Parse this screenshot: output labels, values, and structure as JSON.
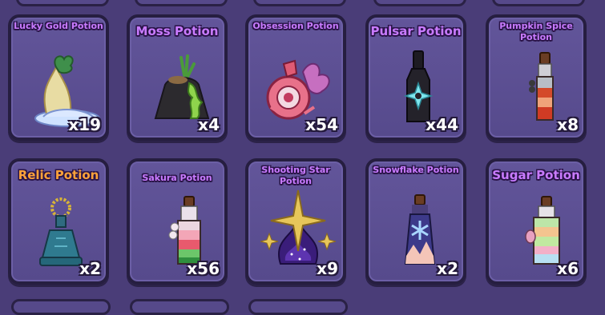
{
  "inventory": {
    "items": [
      {
        "name": "Lucky Gold Potion",
        "count": "x19",
        "icon": "lucky-gold-potion-icon"
      },
      {
        "name": "Moss Potion",
        "count": "x4",
        "icon": "moss-potion-icon"
      },
      {
        "name": "Obsession Potion",
        "count": "x54",
        "icon": "obsession-potion-icon"
      },
      {
        "name": "Pulsar Potion",
        "count": "x44",
        "icon": "pulsar-potion-icon"
      },
      {
        "name": "Pumpkin Spice Potion",
        "count": "x8",
        "icon": "pumpkin-spice-potion-icon"
      },
      {
        "name": "Relic Potion",
        "count": "x2",
        "icon": "relic-potion-icon"
      },
      {
        "name": "Sakura Potion",
        "count": "x56",
        "icon": "sakura-potion-icon"
      },
      {
        "name": "Shooting Star Potion",
        "count": "x9",
        "icon": "shooting-star-potion-icon"
      },
      {
        "name": "Snowflake Potion",
        "count": "x2",
        "icon": "snowflake-potion-icon"
      },
      {
        "name": "Sugar Potion",
        "count": "x6",
        "icon": "sugar-potion-icon"
      }
    ]
  },
  "colors": {
    "background": "#4a3d78",
    "card": "#5c4f93",
    "card_border": "#261e40",
    "name_text": "#c97bff",
    "relic_name_text": "#ffa23a",
    "count_text": "#ffffff"
  }
}
